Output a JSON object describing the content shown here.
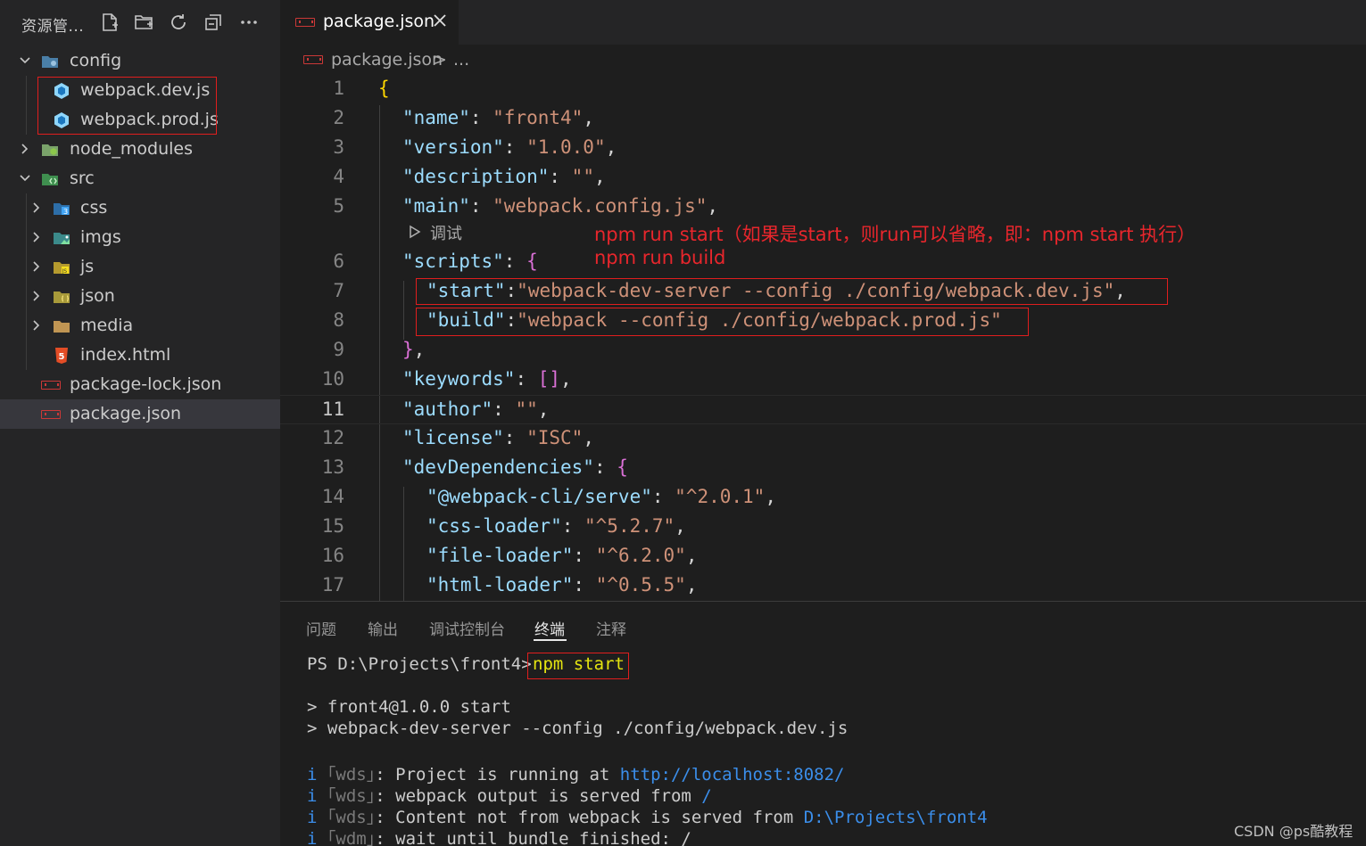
{
  "explorer": {
    "title": "资源管...",
    "header_icons": [
      "new-file-icon",
      "new-folder-icon",
      "refresh-icon",
      "collapse-all-icon",
      "more-icon"
    ],
    "items": [
      {
        "label": "config",
        "icon": "folder-config-icon",
        "expanded": true
      },
      {
        "label": "webpack.dev.js",
        "icon": "webpack-icon"
      },
      {
        "label": "webpack.prod.js",
        "icon": "webpack-icon"
      },
      {
        "label": "node_modules",
        "icon": "folder-node-icon",
        "expanded": false
      },
      {
        "label": "src",
        "icon": "folder-src-icon",
        "expanded": true
      },
      {
        "label": "css",
        "icon": "folder-css-icon",
        "expanded": false
      },
      {
        "label": "imgs",
        "icon": "folder-images-icon",
        "expanded": false
      },
      {
        "label": "js",
        "icon": "folder-js-icon",
        "expanded": false
      },
      {
        "label": "json",
        "icon": "folder-json-icon",
        "expanded": false
      },
      {
        "label": "media",
        "icon": "folder-icon",
        "expanded": false
      },
      {
        "label": "index.html",
        "icon": "html5-icon"
      },
      {
        "label": "package-lock.json",
        "icon": "npm-icon"
      },
      {
        "label": "package.json",
        "icon": "npm-icon",
        "selected": true
      }
    ]
  },
  "editor": {
    "tab": {
      "label": "package.json",
      "icon": "npm-icon"
    },
    "breadcrumb": {
      "file": "package.json",
      "separator": ">",
      "more": "..."
    },
    "codelens": "调试",
    "annotations": [
      "npm run start（如果是start，则run可以省略，即：npm start 执行）",
      "npm run build"
    ],
    "lines": {
      "l1": {
        "n": "1",
        "t": "{"
      },
      "l2": {
        "n": "2",
        "k": "\"name\"",
        "c": ": ",
        "v": "\"front4\"",
        "e": ","
      },
      "l3": {
        "n": "3",
        "k": "\"version\"",
        "c": ": ",
        "v": "\"1.0.0\"",
        "e": ","
      },
      "l4": {
        "n": "4",
        "k": "\"description\"",
        "c": ": ",
        "v": "\"\"",
        "e": ","
      },
      "l5": {
        "n": "5",
        "k": "\"main\"",
        "c": ": ",
        "v": "\"webpack.config.js\"",
        "e": ","
      },
      "l6": {
        "n": "6",
        "k": "\"scripts\"",
        "c": ": ",
        "b": "{"
      },
      "l7": {
        "n": "7",
        "k": "\"start\"",
        "c": ":",
        "v": "\"webpack-dev-server --config ./config/webpack.dev.js\"",
        "e": ","
      },
      "l8": {
        "n": "8",
        "k": "\"build\"",
        "c": ":",
        "v": "\"webpack --config ./config/webpack.prod.js\""
      },
      "l9": {
        "n": "9",
        "b": "}",
        "e": ","
      },
      "l10": {
        "n": "10",
        "k": "\"keywords\"",
        "c": ": ",
        "b": "[]",
        "e": ","
      },
      "l11": {
        "n": "11",
        "k": "\"author\"",
        "c": ": ",
        "v": "\"\"",
        "e": ","
      },
      "l12": {
        "n": "12",
        "k": "\"license\"",
        "c": ": ",
        "v": "\"ISC\"",
        "e": ","
      },
      "l13": {
        "n": "13",
        "k": "\"devDependencies\"",
        "c": ": ",
        "b": "{"
      },
      "l14": {
        "n": "14",
        "k": "\"@webpack-cli/serve\"",
        "c": ": ",
        "v": "\"^2.0.1\"",
        "e": ","
      },
      "l15": {
        "n": "15",
        "k": "\"css-loader\"",
        "c": ": ",
        "v": "\"^5.2.7\"",
        "e": ","
      },
      "l16": {
        "n": "16",
        "k": "\"file-loader\"",
        "c": ": ",
        "v": "\"^6.2.0\"",
        "e": ","
      },
      "l17": {
        "n": "17",
        "k": "\"html-loader\"",
        "c": ": ",
        "v": "\"^0.5.5\"",
        "e": ","
      }
    }
  },
  "panel": {
    "tabs": [
      "问题",
      "输出",
      "调试控制台",
      "终端",
      "注释"
    ],
    "active_tab": "终端",
    "terminal": {
      "prompt": "PS D:\\Projects\\front4>",
      "command": "npm start",
      "out1": "> front4@1.0.0 start",
      "out2": "> webpack-dev-server --config ./config/webpack.dev.js",
      "i": "i",
      "wds": "｢wds｣",
      "wdm": "｢wdm｣",
      "colon": ": ",
      "l1_text": "Project is running at ",
      "l1_link": "http://localhost:8082/",
      "l2_text": "webpack output is served from ",
      "l2_link": "/",
      "l3_text": "Content not from webpack is served from ",
      "l3_link": "D:\\Projects\\front4",
      "l4_text": "wait until bundle finished: /"
    }
  },
  "watermark": "CSDN @ps酷教程",
  "colors": {
    "annotation_red": "#e8262c",
    "json_key": "#9cdcfe",
    "json_string": "#ce9178",
    "bracket_gold": "#ffd700",
    "bracket_pink": "#da70d6",
    "bracket_blue": "#179fff",
    "terminal_link": "#3b8eea",
    "command_yellow": "#e5e510"
  }
}
